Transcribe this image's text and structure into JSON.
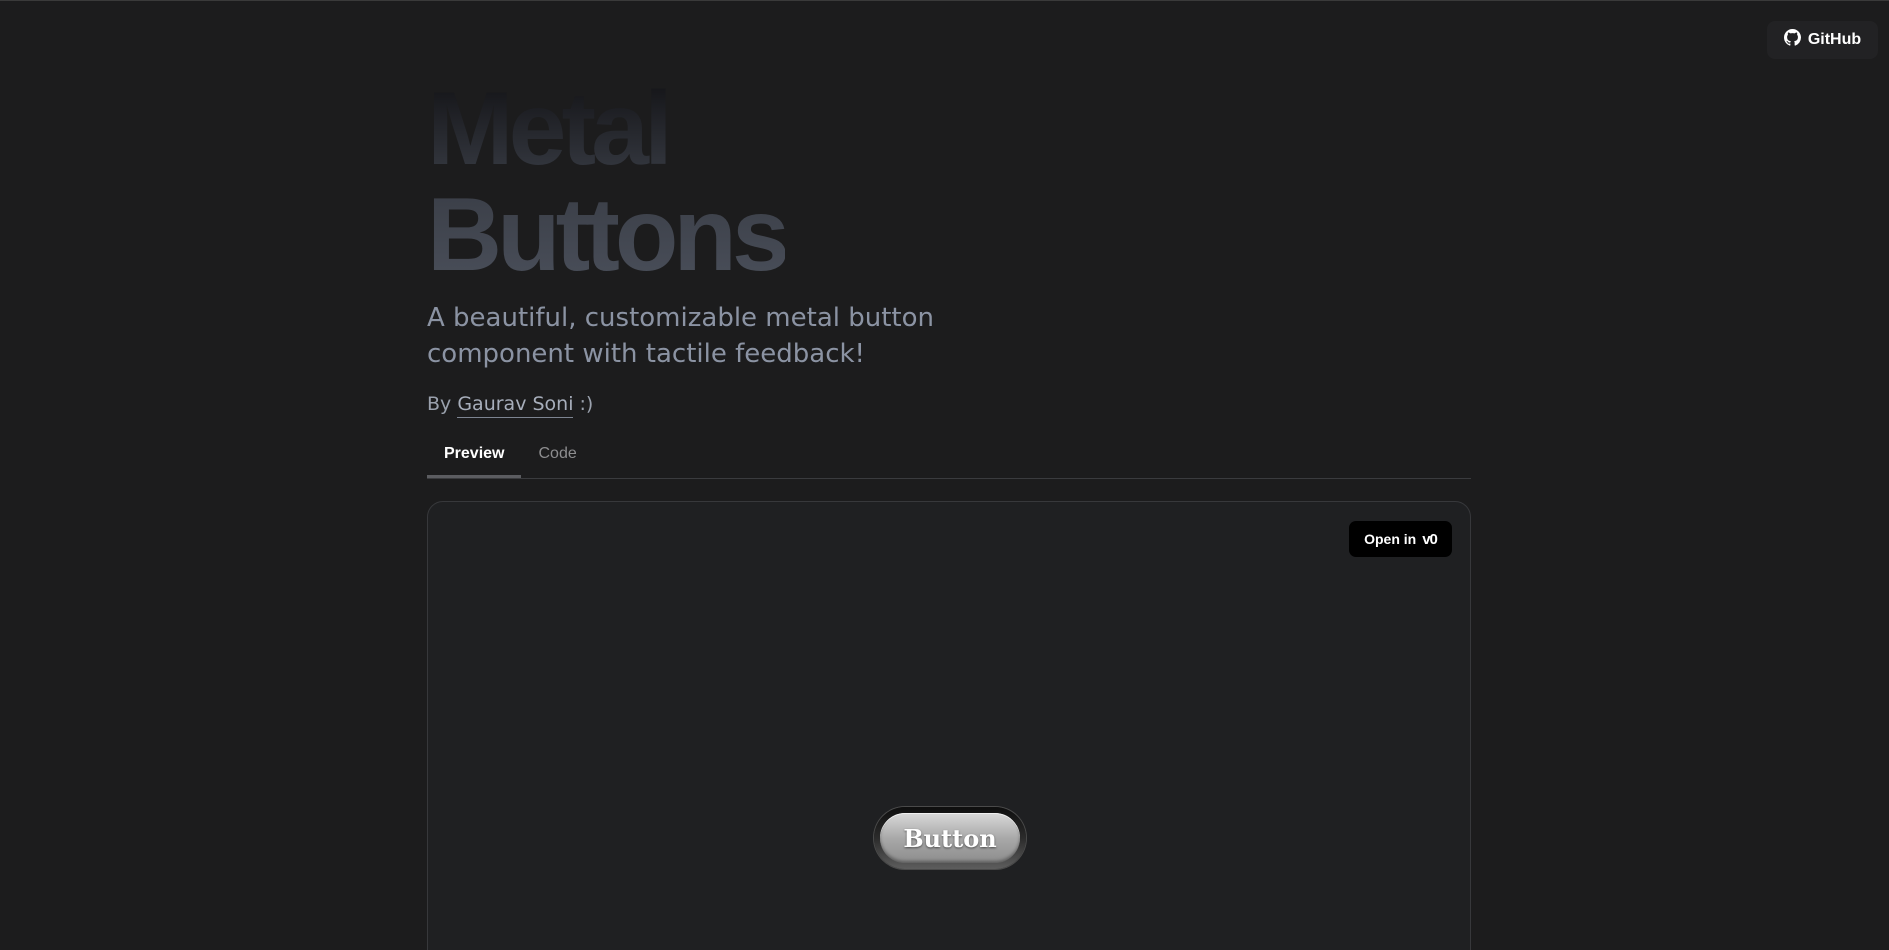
{
  "header": {
    "github_label": "GitHub"
  },
  "hero": {
    "title_line1": "Metal",
    "title_line2": "Buttons",
    "subtitle": "A beautiful, customizable metal button component with tactile feedback!",
    "byline_prefix": "By",
    "author": "Gaurav Soni",
    "byline_suffix": ":)"
  },
  "tabs": [
    {
      "label": "Preview",
      "active": true
    },
    {
      "label": "Code",
      "active": false
    }
  ],
  "preview": {
    "open_in_label": "Open in",
    "v0_logo": "v0",
    "button_label": "Button"
  },
  "colors": {
    "background": "#1c1c1d",
    "panel": "#1f2022",
    "subtitle_text": "#8b93a3"
  },
  "icons": {
    "github": "github-icon"
  }
}
